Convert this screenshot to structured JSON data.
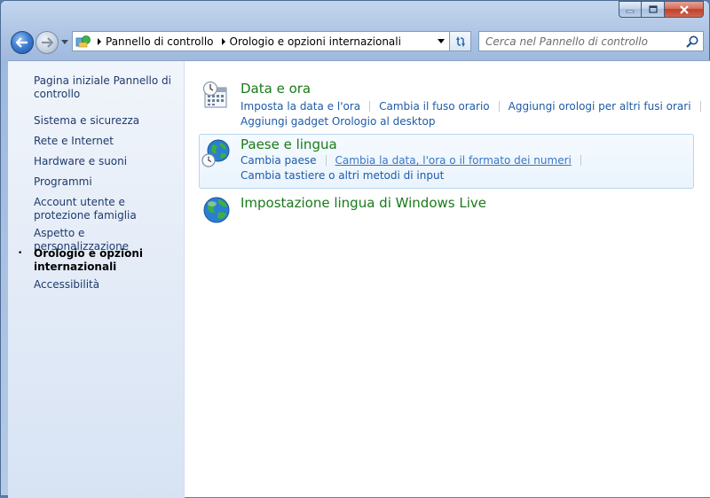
{
  "window": {
    "caption_buttons": [
      "minimize",
      "maximize",
      "close"
    ]
  },
  "navbar": {
    "breadcrumbs": [
      "Pannello di controllo",
      "Orologio e opzioni internazionali"
    ],
    "search": {
      "placeholder": "Cerca nel Pannello di controllo",
      "value": ""
    }
  },
  "sidebar": {
    "items": [
      {
        "label": "Pagina iniziale Pannello di controllo",
        "active": false
      },
      {
        "label": "Sistema e sicurezza",
        "active": false
      },
      {
        "label": "Rete e Internet",
        "active": false
      },
      {
        "label": "Hardware e suoni",
        "active": false
      },
      {
        "label": "Programmi",
        "active": false
      },
      {
        "label": "Account utente e protezione famiglia",
        "active": false
      },
      {
        "label": "Aspetto e personalizzazione",
        "active": false
      },
      {
        "label": "Orologio e opzioni internazionali",
        "active": true
      },
      {
        "label": "Accessibilità",
        "active": false
      }
    ],
    "active_bullet": "•"
  },
  "main": {
    "categories": [
      {
        "title": "Data e ora",
        "icon": "calendar-clock-icon",
        "tasks": [
          [
            "Imposta la data e l'ora",
            "Cambia il fuso orario",
            "Aggiungi orologi per altri fusi orari"
          ],
          [
            "Aggiungi gadget Orologio al desktop"
          ]
        ]
      },
      {
        "title": "Paese e lingua",
        "icon": "globe-clock-icon",
        "hovered": true,
        "tasks": [
          [
            "Cambia paese",
            "Cambia la data, l'ora o il formato dei numeri"
          ],
          [
            "Cambia tastiere o altri metodi di input"
          ]
        ]
      },
      {
        "title": "Impostazione lingua di Windows Live",
        "icon": "globe-icon",
        "tasks": []
      }
    ]
  },
  "colors": {
    "category_title": "#1a7a1a",
    "task_link": "#1e5aa8",
    "sidebar_link": "#1e3a6c",
    "close_button": "#c0402c"
  }
}
